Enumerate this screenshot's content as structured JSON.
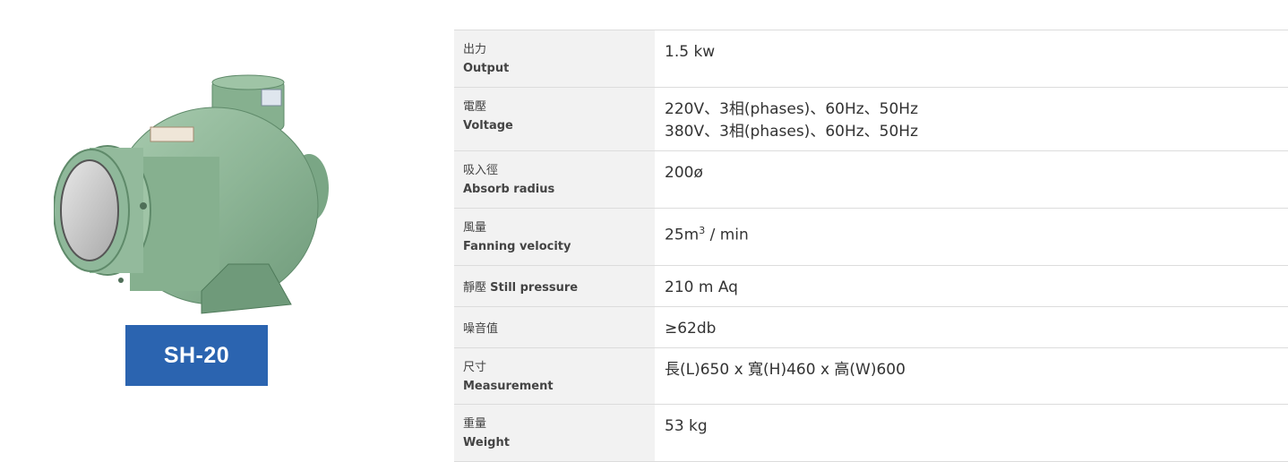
{
  "product": {
    "model": "SH-20",
    "image_icon": "blower-fan-image"
  },
  "specs": [
    {
      "zh": "出力",
      "en": "Output",
      "value": [
        "1.5 kw"
      ]
    },
    {
      "zh": "電壓",
      "en": "Voltage",
      "value": [
        "220V、3相(phases)、60Hz、50Hz",
        "380V、3相(phases)、60Hz、50Hz"
      ]
    },
    {
      "zh": "吸入徑",
      "en": "Absorb radius",
      "value": [
        "200ø"
      ]
    },
    {
      "zh": "風量",
      "en": "Fanning velocity",
      "value_main": "25m",
      "value_sup": "3",
      "value_rest": " / min"
    },
    {
      "zh": "靜壓",
      "en": "Still pressure",
      "value": [
        "210 m Aq"
      ]
    },
    {
      "zh": "噪音值",
      "en": "",
      "value": [
        "≥62db"
      ]
    },
    {
      "zh": "尺寸",
      "en": "Measurement",
      "value": [
        "長(L)650 x 寬(H)460 x 高(W)600"
      ]
    },
    {
      "zh": "重量",
      "en": "Weight",
      "value": [
        "53 kg"
      ]
    }
  ],
  "colors": {
    "badge": "#2b64b0",
    "label_bg": "#f2f2f2",
    "machine_green": "#8fb89a"
  }
}
